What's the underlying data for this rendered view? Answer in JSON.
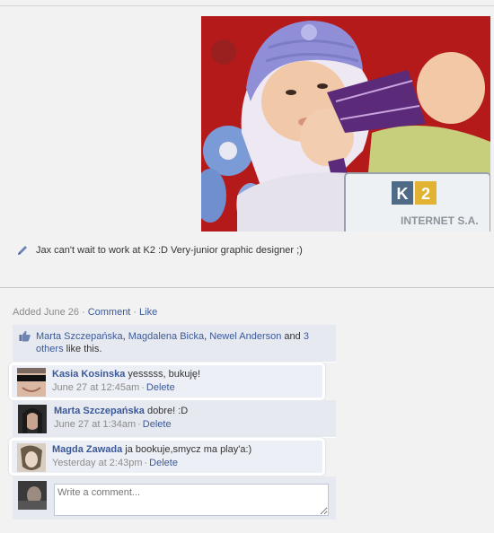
{
  "post": {
    "caption": "Jax can't wait to work at K2 :D Very-junior graphic designer ;)",
    "photo_badge_brand": "K2",
    "photo_badge_text": "INTERNET S.A."
  },
  "meta": {
    "added": "Added June 26",
    "comment_link": "Comment",
    "like_link": "Like",
    "separator": "·"
  },
  "likes": {
    "names": [
      "Marta Szczepańska",
      "Magdalena Bicka",
      "Newel Anderson"
    ],
    "and_text": " and ",
    "others_link": "3 others",
    "suffix": " like this.",
    "name_sep": ", "
  },
  "comments": [
    {
      "author": "Kasia Kosinska",
      "text": " yesssss, bukuję!",
      "time": "June 27 at 12:45am",
      "delete": "Delete"
    },
    {
      "author": "Marta Szczepańska",
      "text": " dobre! :D",
      "time": "June 27 at 1:34am",
      "delete": "Delete"
    },
    {
      "author": "Magda Zawada",
      "text": " ja bookuje,smycz ma play'a:)",
      "time": "Yesterday at 2:43pm",
      "delete": "Delete"
    }
  ],
  "composer": {
    "placeholder": "Write a comment..."
  },
  "colors": {
    "link": "#3b5998",
    "feedback_bg": "#e7e9f0",
    "page_bg": "#f2f2f2"
  }
}
